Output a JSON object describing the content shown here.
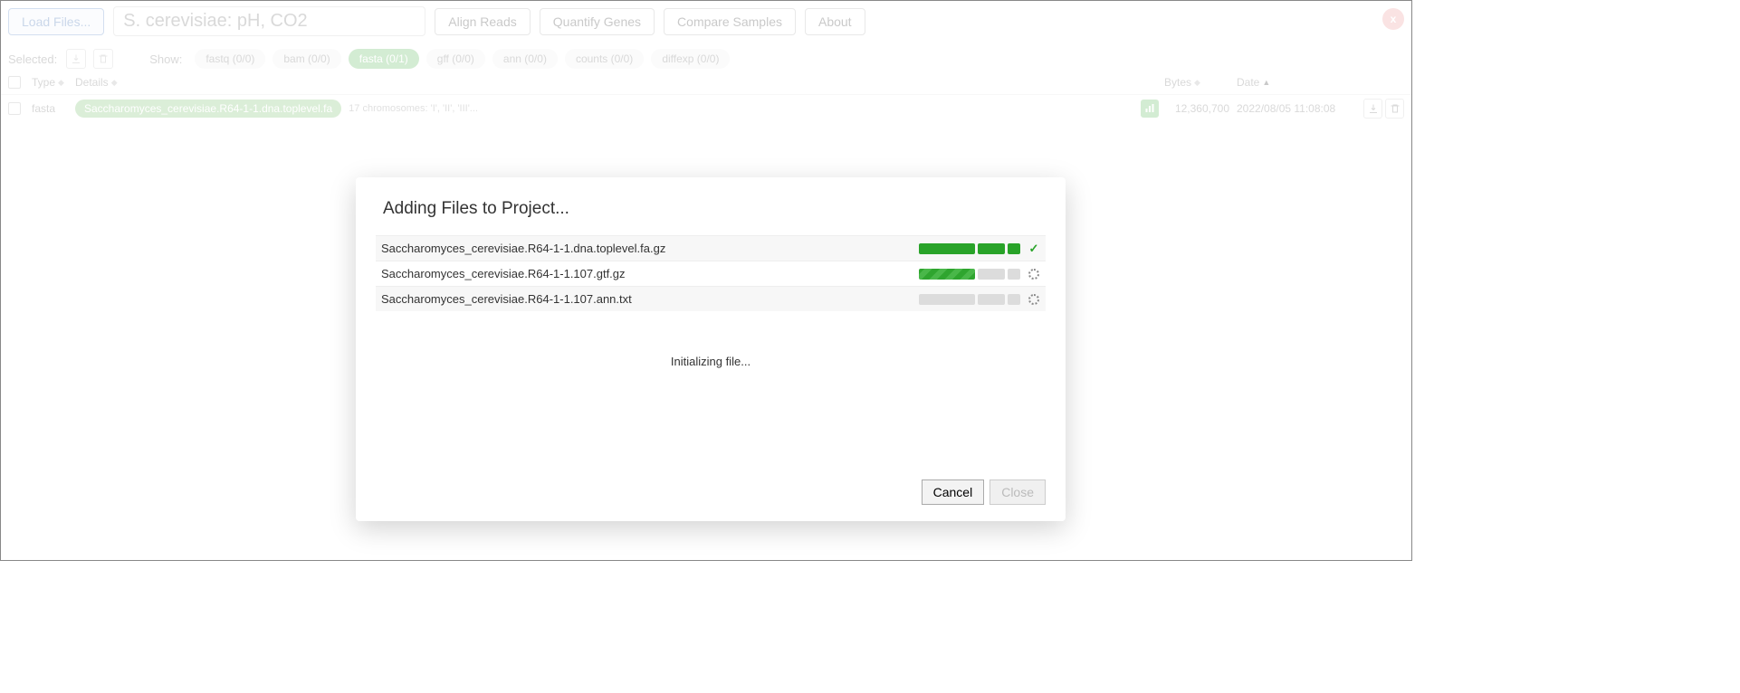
{
  "toolbar": {
    "load_files": "Load Files...",
    "project_title": "S. cerevisiae: pH, CO2",
    "align_reads": "Align Reads",
    "quantify_genes": "Quantify Genes",
    "compare_samples": "Compare Samples",
    "about": "About",
    "close": "x"
  },
  "filterbar": {
    "selected_label": "Selected:",
    "show_label": "Show:",
    "pills": {
      "fastq": "fastq (0/0)",
      "bam": "bam (0/0)",
      "fasta": "fasta (0/1)",
      "gff": "gff (0/0)",
      "ann": "ann (0/0)",
      "counts": "counts (0/0)",
      "diffexp": "diffexp (0/0)"
    }
  },
  "table": {
    "headers": {
      "type": "Type",
      "details": "Details",
      "bytes": "Bytes",
      "date": "Date"
    },
    "row": {
      "type": "fasta",
      "filename": "Saccharomyces_cerevisiae.R64-1-1.dna.toplevel.fa",
      "desc": "17 chromosomes: 'I', 'II', 'III'...",
      "bytes": "12,360,700",
      "date": "2022/08/05 11:08:08"
    }
  },
  "modal": {
    "title": "Adding Files to Project...",
    "files": {
      "f1": "Saccharomyces_cerevisiae.R64-1-1.dna.toplevel.fa.gz",
      "f2": "Saccharomyces_cerevisiae.R64-1-1.107.gtf.gz",
      "f3": "Saccharomyces_cerevisiae.R64-1-1.107.ann.txt"
    },
    "status": "Initializing file...",
    "cancel": "Cancel",
    "close": "Close"
  }
}
